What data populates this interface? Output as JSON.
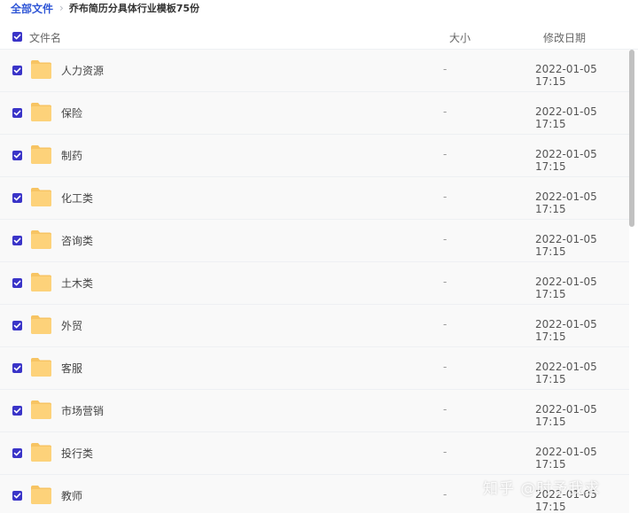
{
  "breadcrumb": {
    "root": "全部文件",
    "separator": "›",
    "current": "乔布简历分具体行业模板75份"
  },
  "header": {
    "name_label": "文件名",
    "size_label": "大小",
    "date_label": "修改日期",
    "all_selected": true
  },
  "files": [
    {
      "name": "人力资源",
      "size": "-",
      "modified": "2022-01-05 17:15",
      "selected": true
    },
    {
      "name": "保险",
      "size": "-",
      "modified": "2022-01-05 17:15",
      "selected": true
    },
    {
      "name": "制药",
      "size": "-",
      "modified": "2022-01-05 17:15",
      "selected": true
    },
    {
      "name": "化工类",
      "size": "-",
      "modified": "2022-01-05 17:15",
      "selected": true
    },
    {
      "name": "咨询类",
      "size": "-",
      "modified": "2022-01-05 17:15",
      "selected": true
    },
    {
      "name": "土木类",
      "size": "-",
      "modified": "2022-01-05 17:15",
      "selected": true
    },
    {
      "name": "外贸",
      "size": "-",
      "modified": "2022-01-05 17:15",
      "selected": true
    },
    {
      "name": "客服",
      "size": "-",
      "modified": "2022-01-05 17:15",
      "selected": true
    },
    {
      "name": "市场营销",
      "size": "-",
      "modified": "2022-01-05 17:15",
      "selected": true
    },
    {
      "name": "投行类",
      "size": "-",
      "modified": "2022-01-05 17:15",
      "selected": true
    },
    {
      "name": "教师",
      "size": "-",
      "modified": "2022-01-05 17:15",
      "selected": true
    }
  ],
  "icons": {
    "folder": "folder-icon",
    "checkbox": "checkbox-checked-icon"
  },
  "colors": {
    "accent": "#3a34c8",
    "link": "#2f56d6",
    "folder": "#fdd27a",
    "row_bg": "#f9f9f9"
  },
  "watermark": "知乎 @时予我求"
}
